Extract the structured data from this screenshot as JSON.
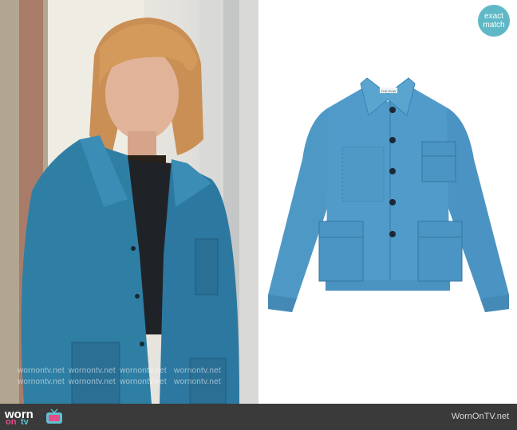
{
  "badge": {
    "line1": "exact",
    "line2": "match"
  },
  "watermarks": [
    "wornontv.net",
    "wornontv.net",
    "wornontv.net",
    "wornontv.net",
    "wornontv.net",
    "wornontv.net",
    "wornontv.net",
    "wornontv.net"
  ],
  "product": {
    "label_text": "THE ROW"
  },
  "footer": {
    "brand_worn": "worn",
    "brand_on": "on",
    "brand_tv": "tv",
    "site": "WornOnTV.net"
  },
  "colors": {
    "denim": "#4e98c6",
    "denim_dark": "#2f6d96",
    "photo_jacket": "#2f7fa5",
    "badge": "#5fb8c6",
    "footer_bg": "#3a3a3a",
    "brand_pink": "#e84b8a",
    "brand_teal": "#5fc1cf"
  }
}
